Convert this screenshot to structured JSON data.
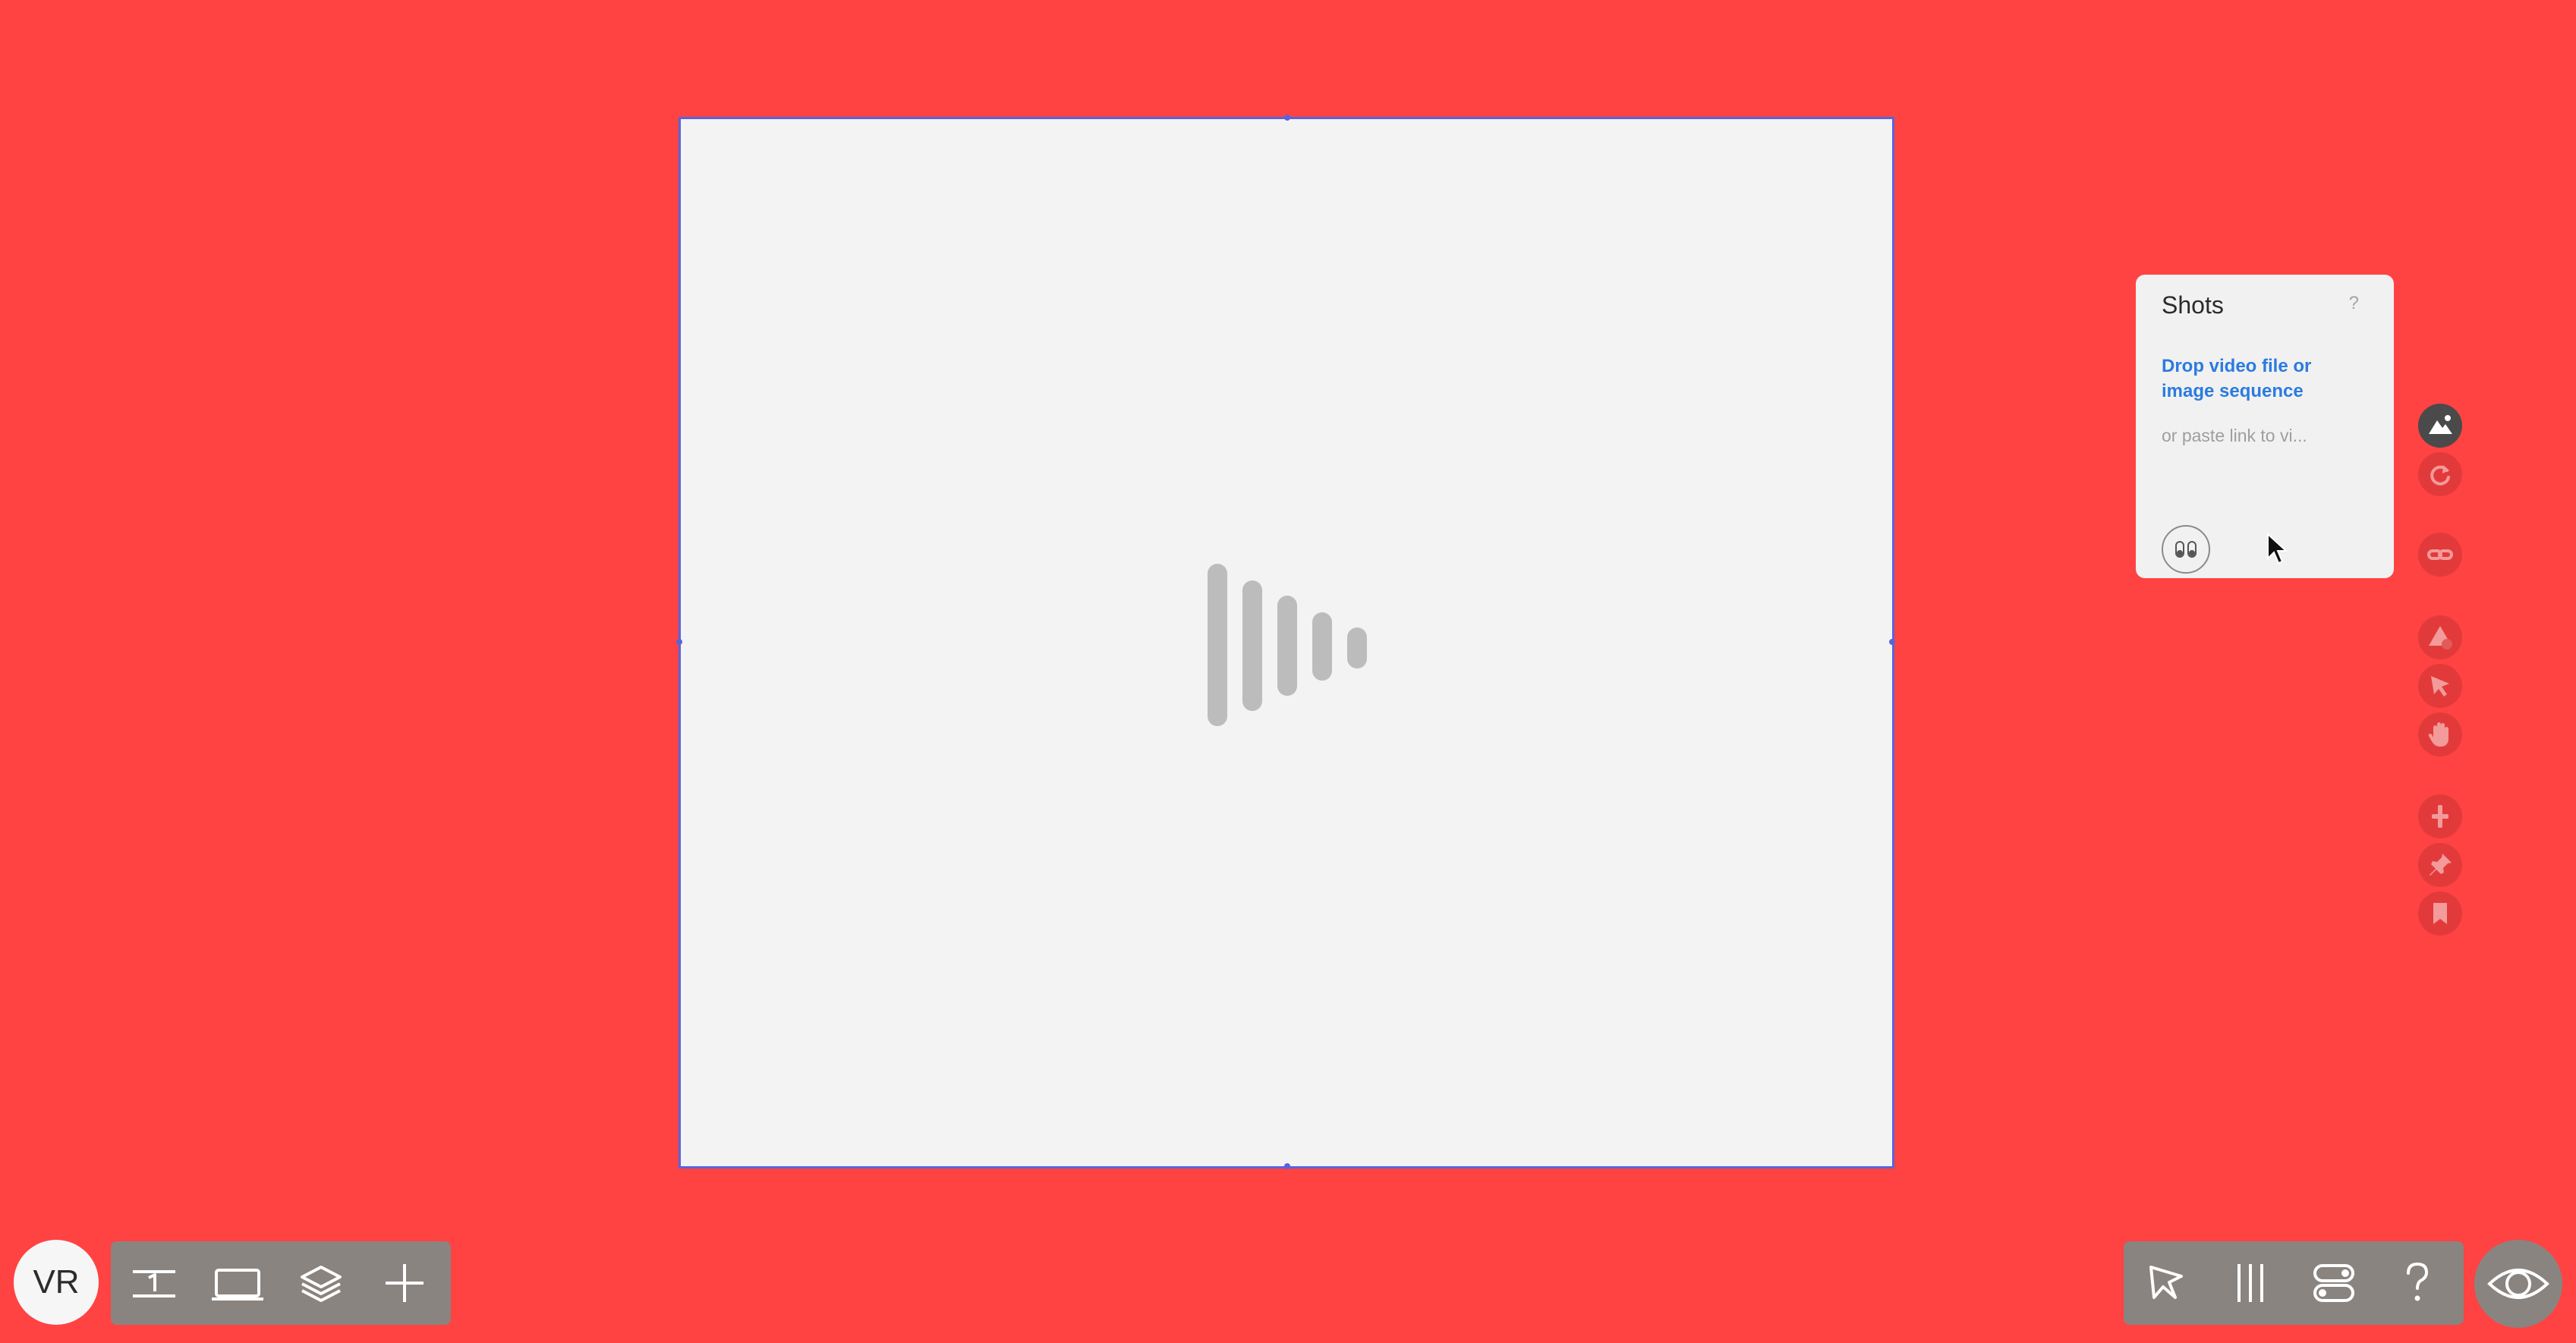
{
  "shots_panel": {
    "title": "Shots",
    "help": "?",
    "drop_label": "Drop video file or image sequence",
    "paste_placeholder": "or paste link to vi..."
  },
  "user": {
    "initials": "VR"
  },
  "colors": {
    "background": "#ff4343",
    "frame_border": "#5b63d9",
    "canvas": "#f3f3f3",
    "link": "#2b7be0",
    "toolbar": "#8a8480",
    "active_tool": "#4a4a4a"
  },
  "right_tools": [
    {
      "name": "image-icon",
      "active": true
    },
    {
      "name": "redo-icon",
      "active": false
    },
    {
      "name": "link-icon",
      "active": false
    },
    {
      "name": "shapes-icon",
      "active": false
    },
    {
      "name": "pointer-icon",
      "active": false
    },
    {
      "name": "hand-icon",
      "active": false
    },
    {
      "name": "add-icon",
      "active": false
    },
    {
      "name": "pin-icon",
      "active": false
    },
    {
      "name": "bookmark-icon",
      "active": false
    }
  ],
  "bottom_left_tools": [
    "page-one-icon",
    "screen-icon",
    "layers-icon",
    "plus-icon"
  ],
  "bottom_right_tools": [
    "select-icon",
    "columns-icon",
    "toggles-icon",
    "help-icon",
    "eye-icon"
  ]
}
